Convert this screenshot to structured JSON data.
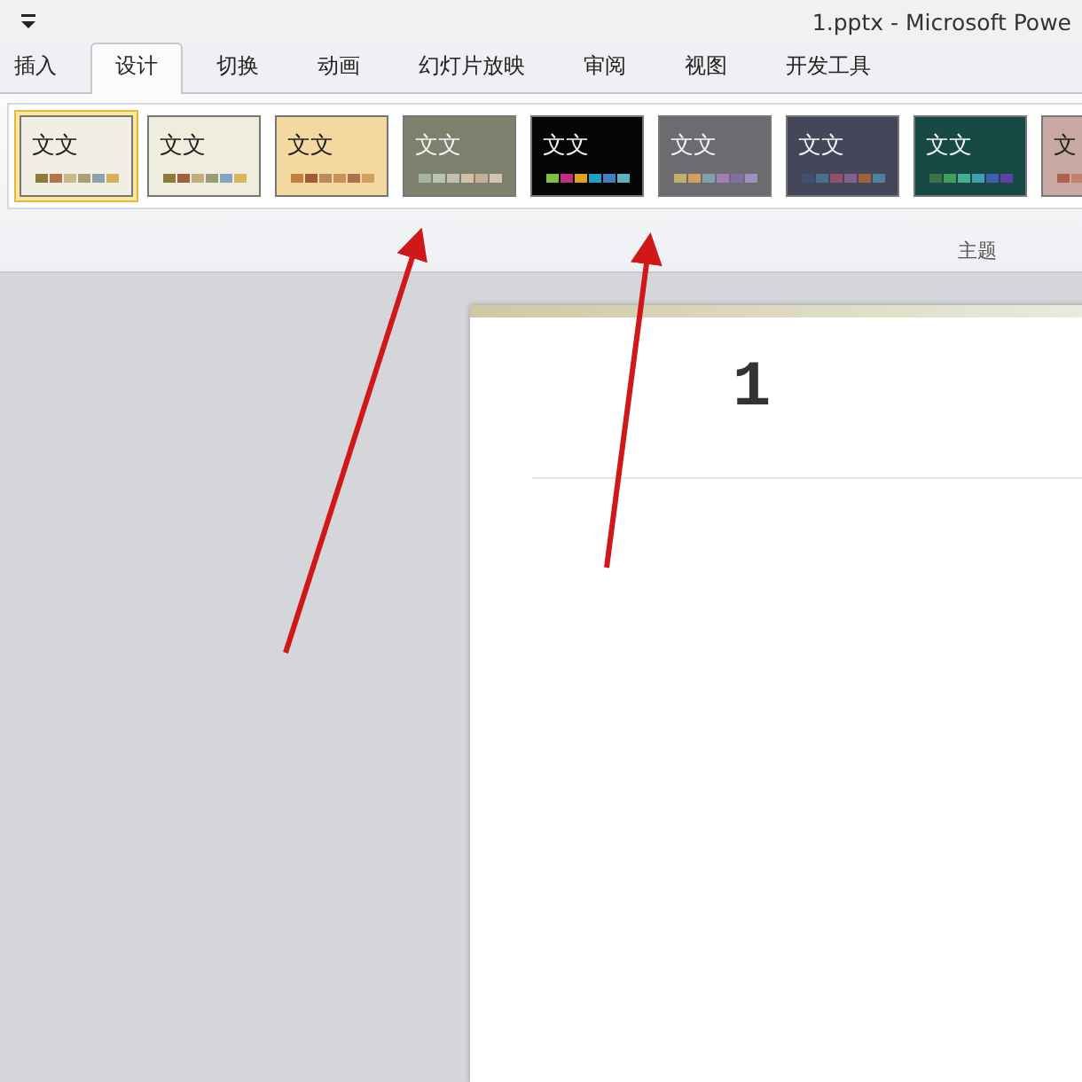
{
  "window": {
    "title": "1.pptx - Microsoft Powe"
  },
  "tabs": [
    {
      "label": "插入",
      "selected": false
    },
    {
      "label": "设计",
      "selected": true
    },
    {
      "label": "切换",
      "selected": false
    },
    {
      "label": "动画",
      "selected": false
    },
    {
      "label": "幻灯片放映",
      "selected": false
    },
    {
      "label": "审阅",
      "selected": false
    },
    {
      "label": "视图",
      "selected": false
    },
    {
      "label": "开发工具",
      "selected": false
    }
  ],
  "themes": {
    "group_label": "主题",
    "items": [
      {
        "label": "文文",
        "selected": true,
        "color": "#f1efe4",
        "swatches": [
          {
            "color": "#8c7b3a"
          },
          {
            "color": "#b5734a"
          },
          {
            "color": "#c9b98a"
          },
          {
            "color": "#a8a07a"
          },
          {
            "color": "#8fa0b0"
          },
          {
            "color": "#d4b060"
          }
        ]
      },
      {
        "label": "文文",
        "selected": false,
        "color": "#efedde",
        "swatches": [
          {
            "color": "#8c7b3a"
          },
          {
            "color": "#a06040"
          },
          {
            "color": "#c4ac7c"
          },
          {
            "color": "#9c9c74"
          },
          {
            "color": "#84a4c0"
          },
          {
            "color": "#d8b460"
          }
        ]
      },
      {
        "label": "文文",
        "selected": false,
        "color": "#f3d9a0",
        "swatches": [
          {
            "color": "#c08040"
          },
          {
            "color": "#a05a3a"
          },
          {
            "color": "#b88a60"
          },
          {
            "color": "#c8905a"
          },
          {
            "color": "#b07050"
          },
          {
            "color": "#d0a060"
          }
        ]
      },
      {
        "label": "文文",
        "selected": false,
        "color": "#7c806c",
        "swatches": [
          {
            "color": "#a6b4a0"
          },
          {
            "color": "#b8c4b4"
          },
          {
            "color": "#c4c0b0"
          },
          {
            "color": "#d0c0a8"
          },
          {
            "color": "#c8b098"
          },
          {
            "color": "#d4c4b4"
          }
        ]
      },
      {
        "label": "文文",
        "selected": false,
        "color": "#050505",
        "swatches": [
          {
            "color": "#80c040"
          },
          {
            "color": "#c03080"
          },
          {
            "color": "#e0a020"
          },
          {
            "color": "#20a0c0"
          },
          {
            "color": "#4080c0"
          },
          {
            "color": "#60b0c0"
          }
        ]
      },
      {
        "label": "文文",
        "selected": false,
        "color": "#6c6c70",
        "swatches": [
          {
            "color": "#c0b070"
          },
          {
            "color": "#d0a060"
          },
          {
            "color": "#80a0b0"
          },
          {
            "color": "#a080b0"
          },
          {
            "color": "#8070a0"
          },
          {
            "color": "#a090c0"
          }
        ]
      },
      {
        "label": "文文",
        "selected": false,
        "color": "#44465a",
        "swatches": [
          {
            "color": "#405070"
          },
          {
            "color": "#4a7090"
          },
          {
            "color": "#905070"
          },
          {
            "color": "#806090"
          },
          {
            "color": "#a06040"
          },
          {
            "color": "#5080a0"
          }
        ]
      },
      {
        "label": "文文",
        "selected": false,
        "color": "#174a44",
        "swatches": [
          {
            "color": "#40704a"
          },
          {
            "color": "#40a060"
          },
          {
            "color": "#40b090"
          },
          {
            "color": "#40a0b0"
          },
          {
            "color": "#4060b0"
          },
          {
            "color": "#6040a0"
          }
        ]
      },
      {
        "label": "文",
        "selected": false,
        "color": "#c9a8a4",
        "swatches": [
          {
            "color": "#b06050"
          },
          {
            "color": "#c08070"
          }
        ]
      }
    ]
  },
  "slide": {
    "title": "1"
  }
}
